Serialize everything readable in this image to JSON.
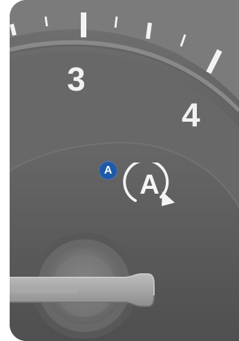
{
  "dial": {
    "label_3": "3",
    "label_4": "4"
  },
  "callout": {
    "label": "A",
    "color": "#1f5aa8"
  },
  "auto_indicator": {
    "letter": "A",
    "icon": "auto-cycle-icon"
  },
  "knob": {
    "icon": "rotary-knob-icon"
  },
  "colors": {
    "panel": "#676767",
    "ring": "#8a8a8a",
    "text": "#f1f1f1"
  }
}
